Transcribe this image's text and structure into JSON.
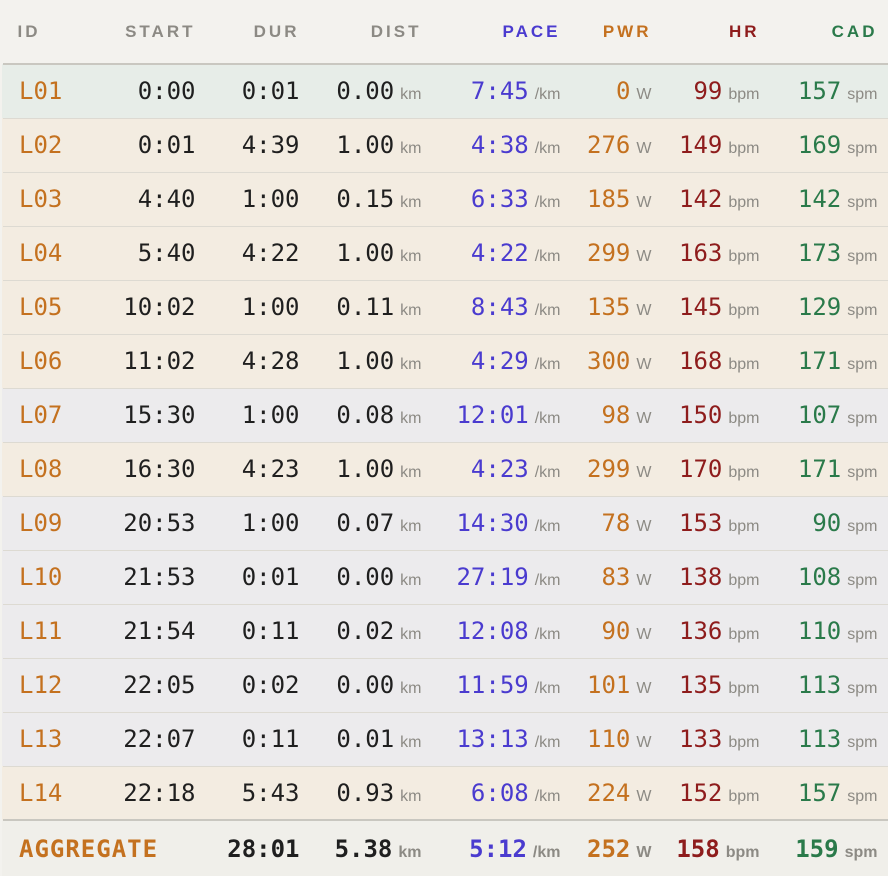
{
  "headers": {
    "id": "ID",
    "start": "START",
    "dur": "DUR",
    "dist": "DIST",
    "pace": "PACE",
    "pwr": "PWR",
    "hr": "HR",
    "cad": "CAD"
  },
  "units": {
    "dist": "km",
    "pace": "/km",
    "pwr": "W",
    "hr": "bpm",
    "cad": "spm"
  },
  "laps": [
    {
      "id": "L01",
      "start": "0:00",
      "dur": "0:01",
      "dist": "0.00",
      "pace": "7:45",
      "pwr": "0",
      "hr": "99",
      "cad": "157",
      "tone": "mint"
    },
    {
      "id": "L02",
      "start": "0:01",
      "dur": "4:39",
      "dist": "1.00",
      "pace": "4:38",
      "pwr": "276",
      "hr": "149",
      "cad": "169",
      "tone": "warm"
    },
    {
      "id": "L03",
      "start": "4:40",
      "dur": "1:00",
      "dist": "0.15",
      "pace": "6:33",
      "pwr": "185",
      "hr": "142",
      "cad": "142",
      "tone": "warm"
    },
    {
      "id": "L04",
      "start": "5:40",
      "dur": "4:22",
      "dist": "1.00",
      "pace": "4:22",
      "pwr": "299",
      "hr": "163",
      "cad": "173",
      "tone": "warm"
    },
    {
      "id": "L05",
      "start": "10:02",
      "dur": "1:00",
      "dist": "0.11",
      "pace": "8:43",
      "pwr": "135",
      "hr": "145",
      "cad": "129",
      "tone": "warm"
    },
    {
      "id": "L06",
      "start": "11:02",
      "dur": "4:28",
      "dist": "1.00",
      "pace": "4:29",
      "pwr": "300",
      "hr": "168",
      "cad": "171",
      "tone": "warm"
    },
    {
      "id": "L07",
      "start": "15:30",
      "dur": "1:00",
      "dist": "0.08",
      "pace": "12:01",
      "pwr": "98",
      "hr": "150",
      "cad": "107",
      "tone": "cool"
    },
    {
      "id": "L08",
      "start": "16:30",
      "dur": "4:23",
      "dist": "1.00",
      "pace": "4:23",
      "pwr": "299",
      "hr": "170",
      "cad": "171",
      "tone": "warm"
    },
    {
      "id": "L09",
      "start": "20:53",
      "dur": "1:00",
      "dist": "0.07",
      "pace": "14:30",
      "pwr": "78",
      "hr": "153",
      "cad": "90",
      "tone": "cool"
    },
    {
      "id": "L10",
      "start": "21:53",
      "dur": "0:01",
      "dist": "0.00",
      "pace": "27:19",
      "pwr": "83",
      "hr": "138",
      "cad": "108",
      "tone": "cool"
    },
    {
      "id": "L11",
      "start": "21:54",
      "dur": "0:11",
      "dist": "0.02",
      "pace": "12:08",
      "pwr": "90",
      "hr": "136",
      "cad": "110",
      "tone": "cool"
    },
    {
      "id": "L12",
      "start": "22:05",
      "dur": "0:02",
      "dist": "0.00",
      "pace": "11:59",
      "pwr": "101",
      "hr": "135",
      "cad": "113",
      "tone": "cool"
    },
    {
      "id": "L13",
      "start": "22:07",
      "dur": "0:11",
      "dist": "0.01",
      "pace": "13:13",
      "pwr": "110",
      "hr": "133",
      "cad": "113",
      "tone": "cool"
    },
    {
      "id": "L14",
      "start": "22:18",
      "dur": "5:43",
      "dist": "0.93",
      "pace": "6:08",
      "pwr": "224",
      "hr": "152",
      "cad": "157",
      "tone": "warm"
    }
  ],
  "aggregate": {
    "id": "AGGREGATE",
    "start": "",
    "dur": "28:01",
    "dist": "5.38",
    "pace": "5:12",
    "pwr": "252",
    "hr": "158",
    "cad": "159"
  },
  "colors": {
    "pace": "#4a3bcf",
    "pwr": "#c4711f",
    "hr": "#8e1c1c",
    "cad": "#2a7a4a",
    "id": "#c4711f",
    "warm_row": "#f3ece1",
    "cool_row": "#ecebed",
    "mint_row": "#e7ede8"
  }
}
